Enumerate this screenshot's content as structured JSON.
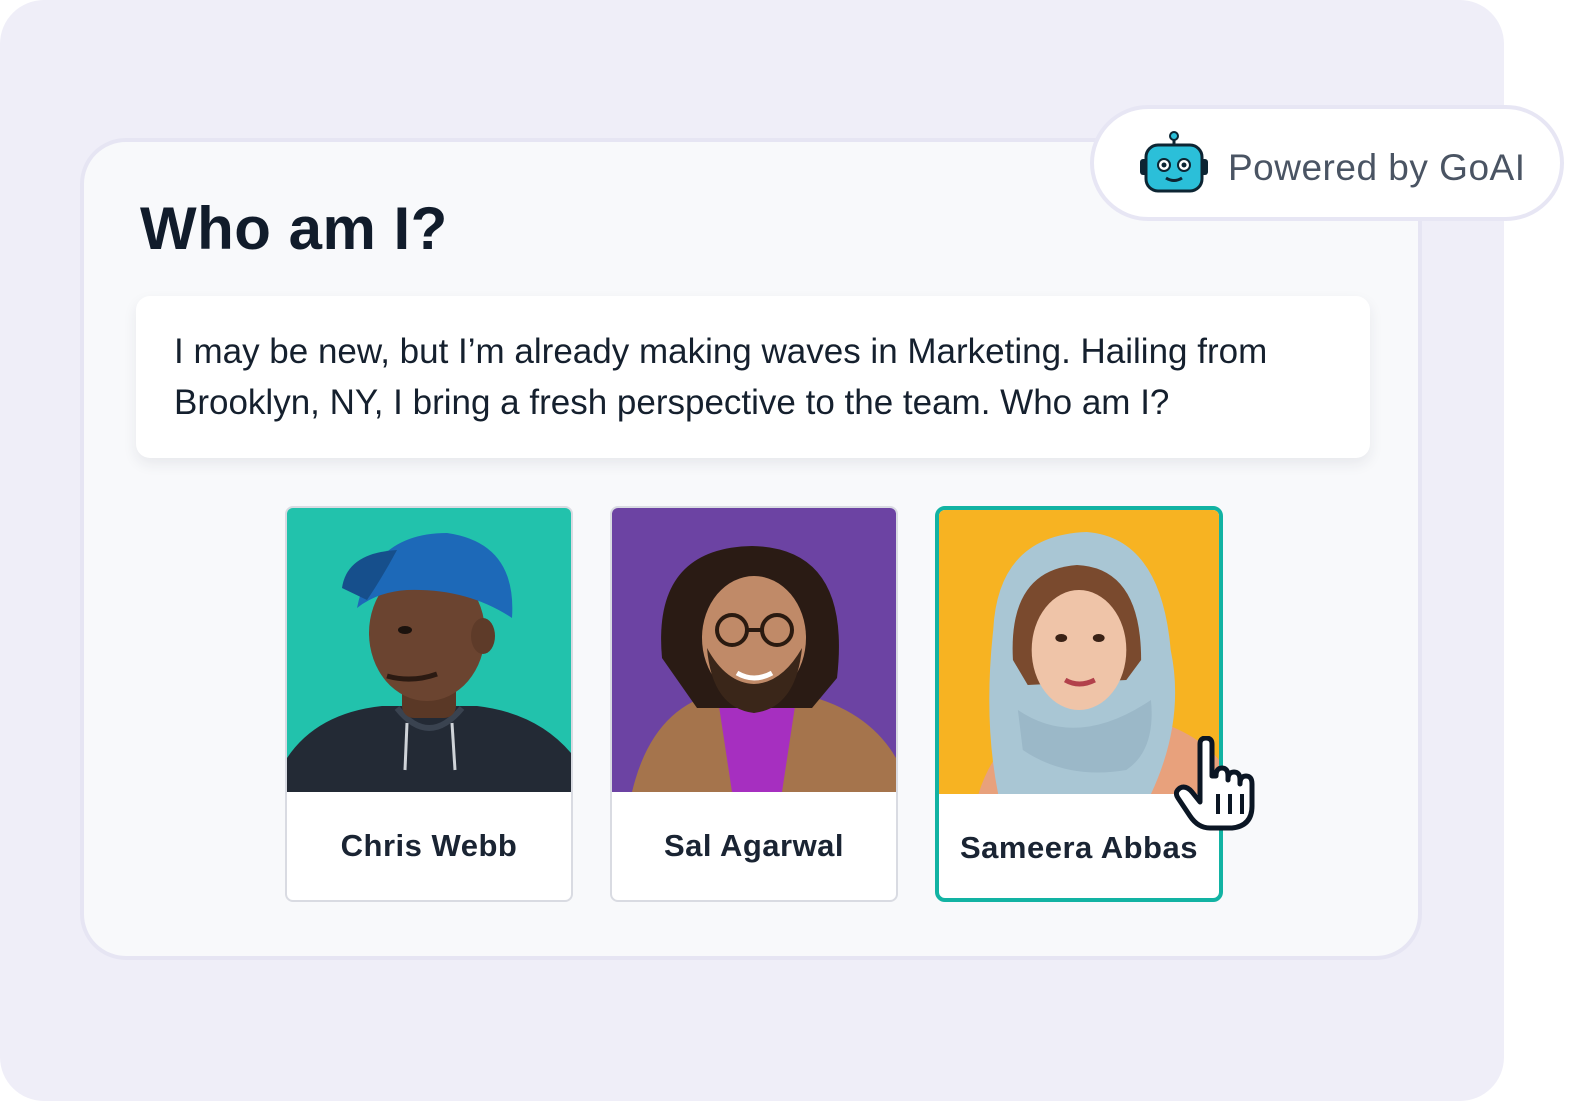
{
  "quiz": {
    "title": "Who am I?",
    "prompt": "I may be new, but I’m already making waves in Marketing. Hailing from Brooklyn, NY,  I bring a fresh perspective to the team. Who am I?",
    "options": [
      {
        "name": "Chris Webb",
        "photo_bg": "#1fbfa9",
        "selected": false
      },
      {
        "name": "Sal Agarwal",
        "photo_bg": "#6c43a3",
        "selected": false
      },
      {
        "name": "Sameera Abbas",
        "photo_bg": "#f7b322",
        "selected": true
      }
    ]
  },
  "badge": {
    "text": "Powered by GoAI",
    "icon": "robot-icon"
  },
  "colors": {
    "accent": "#12b3a3",
    "title": "#111c2b",
    "backdrop": "#efeef8",
    "robot": "#2bbfd9"
  },
  "pointer": {
    "icon": "hand-pointer-icon"
  }
}
